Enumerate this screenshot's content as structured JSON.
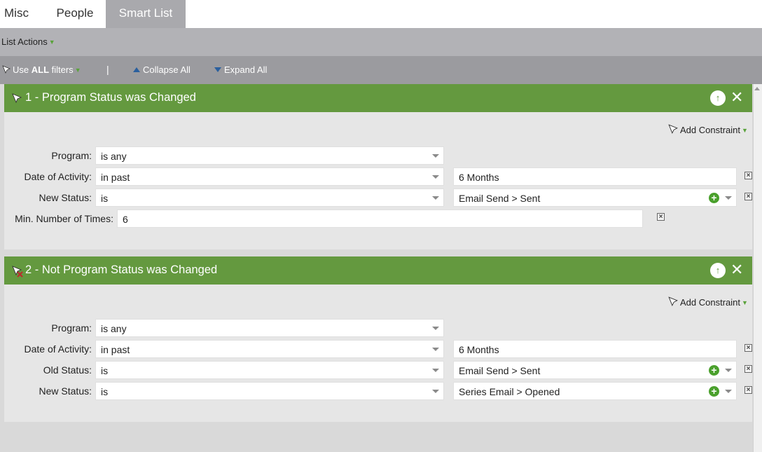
{
  "tabs": [
    {
      "label": "Misc"
    },
    {
      "label": "People"
    },
    {
      "label": "Smart List",
      "active": true
    }
  ],
  "list_actions": {
    "label": "List Actions"
  },
  "filter_toolbar": {
    "use_prefix": "Use ",
    "use_bold": "ALL",
    "use_suffix": " filters",
    "separator": "|",
    "collapse_all": "Collapse All",
    "expand_all": "Expand All"
  },
  "filters": [
    {
      "title": "1 - Program Status was Changed",
      "negated": false,
      "add_constraint": "Add Constraint",
      "rows": [
        {
          "label": "Program:",
          "operator": "is any",
          "value": null
        },
        {
          "label": "Date of Activity:",
          "operator": "in past",
          "value": "6 Months"
        },
        {
          "label": "New Status:",
          "operator": "is",
          "value": "Email Send > Sent",
          "has_plus": true
        },
        {
          "label": "Min. Number of Times:",
          "value": "6"
        }
      ]
    },
    {
      "title": "2 - Not Program Status was Changed",
      "negated": true,
      "add_constraint": "Add Constraint",
      "rows": [
        {
          "label": "Program:",
          "operator": "is any",
          "value": null
        },
        {
          "label": "Date of Activity:",
          "operator": "in past",
          "value": "6 Months"
        },
        {
          "label": "Old Status:",
          "operator": "is",
          "value": "Email Send > Sent",
          "has_plus": true
        },
        {
          "label": "New Status:",
          "operator": "is",
          "value": "Series Email > Opened",
          "has_plus": true
        }
      ]
    }
  ],
  "colors": {
    "panel_header": "#64993f",
    "panel_body": "#e6e6e6",
    "active_tab": "#a9a9ad",
    "accent_green": "#59a23a"
  },
  "icons": {
    "move_up": "arrow-up-circle-icon",
    "remove_filter": "close-icon",
    "add_constraint": "funnel-icon",
    "delete_constraint": "delete-box-icon",
    "add_value": "plus-circle-icon",
    "dropdown": "caret-down-icon"
  }
}
